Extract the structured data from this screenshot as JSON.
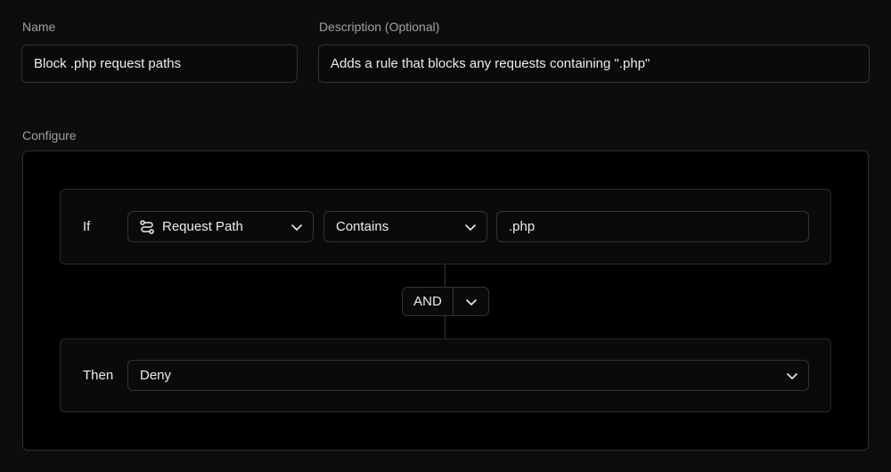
{
  "form": {
    "name_label": "Name",
    "name_value": "Block .php request paths",
    "description_label": "Description (Optional)",
    "description_value": "Adds a rule that blocks any requests containing \".php\"",
    "configure_label": "Configure"
  },
  "rule": {
    "if_label": "If",
    "field_select": {
      "icon": "route-icon",
      "value": "Request Path"
    },
    "operator_select": {
      "value": "Contains"
    },
    "match_value": ".php",
    "logic": {
      "value": "AND"
    },
    "then_label": "Then",
    "action_select": {
      "value": "Deny"
    }
  },
  "colors": {
    "page_background": "#0d0d0d",
    "panel_background": "#000000",
    "card_background": "#0a0a0a",
    "border": "#333333",
    "text": "#ededed",
    "muted_text": "#a0a0a0"
  }
}
